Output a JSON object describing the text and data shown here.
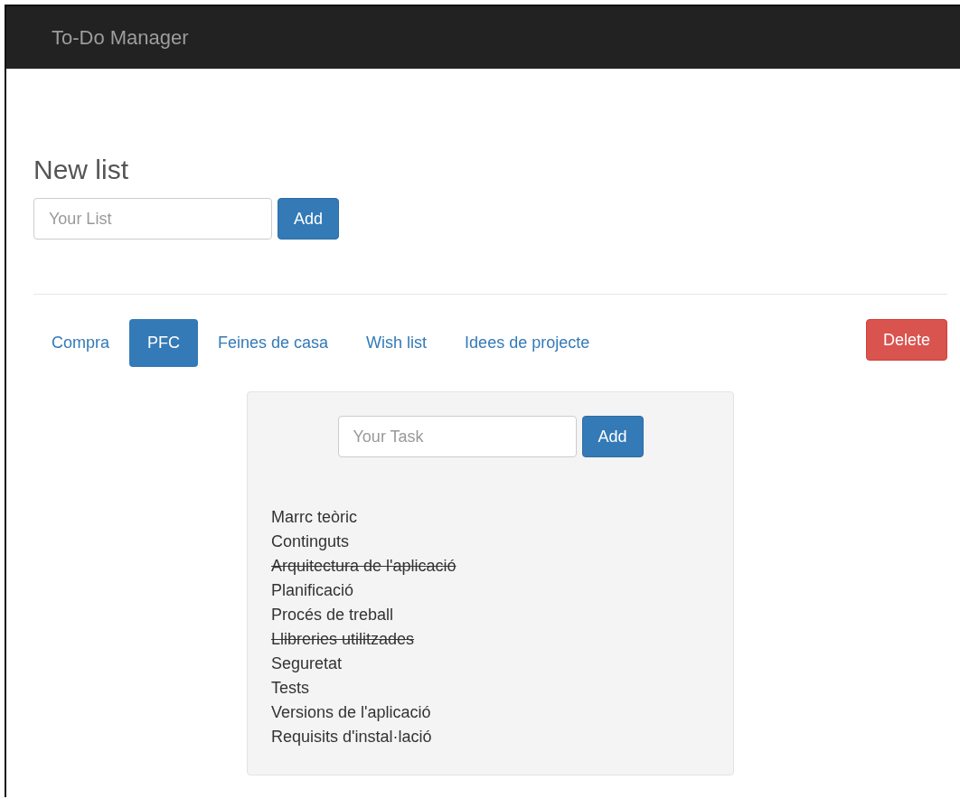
{
  "navbar": {
    "title": "To-Do Manager"
  },
  "new_list": {
    "heading": "New list",
    "placeholder": "Your List",
    "button": "Add"
  },
  "tabs": [
    {
      "label": "Compra",
      "selected": false
    },
    {
      "label": "PFC",
      "selected": true
    },
    {
      "label": "Feines de casa",
      "selected": false
    },
    {
      "label": "Wish list",
      "selected": false
    },
    {
      "label": "Idees de projecte",
      "selected": false
    }
  ],
  "delete_button": "Delete",
  "task_panel": {
    "placeholder": "Your Task",
    "button": "Add",
    "tasks": [
      {
        "text": "Marrc teòric",
        "done": false
      },
      {
        "text": "Continguts",
        "done": false
      },
      {
        "text": "Arquitectura de l'aplicació",
        "done": true
      },
      {
        "text": "Planificació",
        "done": false
      },
      {
        "text": "Procés de treball",
        "done": false
      },
      {
        "text": "Llibreries utilitzades",
        "done": true
      },
      {
        "text": "Seguretat",
        "done": false
      },
      {
        "text": "Tests",
        "done": false
      },
      {
        "text": "Versions de l'aplicació",
        "done": false
      },
      {
        "text": "Requisits d'instal·lació",
        "done": false
      }
    ]
  }
}
